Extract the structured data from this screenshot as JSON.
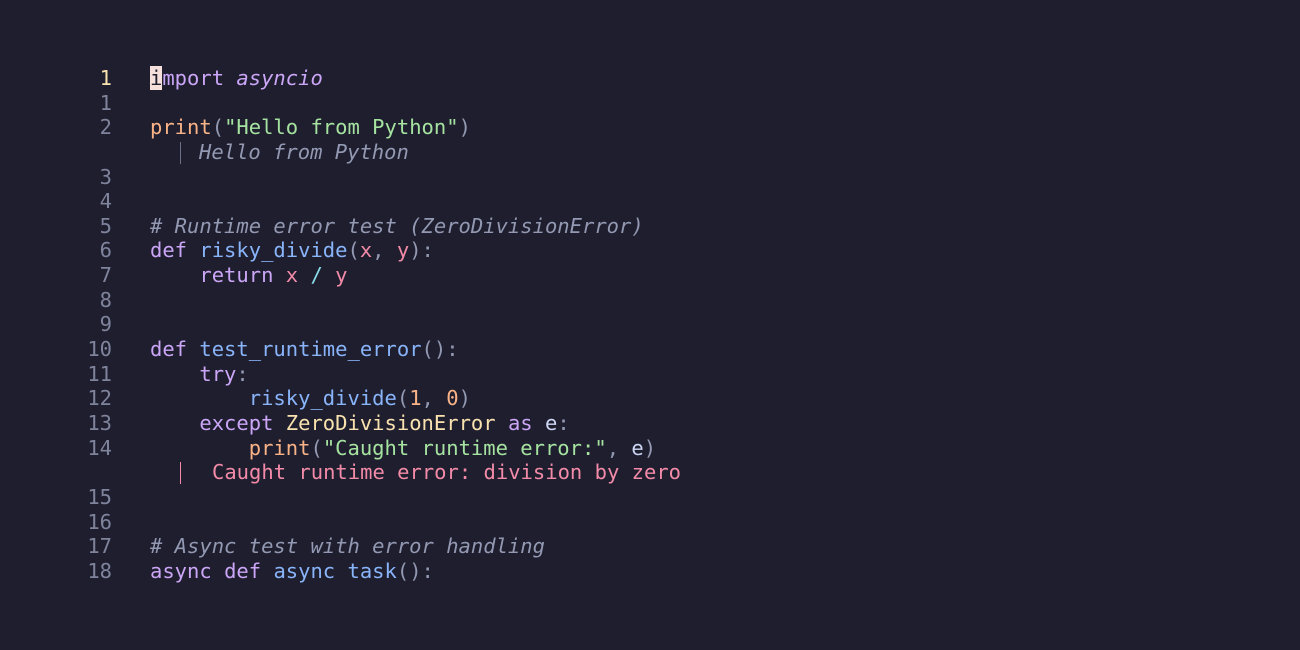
{
  "editor": {
    "theme_colors": {
      "background": "#1e1e2e",
      "keyword": "#cba6f7",
      "function": "#89b4fa",
      "builtin": "#fab387",
      "string": "#a6e3a1",
      "comment": "#9399b2",
      "error_output": "#f38ba8",
      "current_line_number": "#f9e2af"
    },
    "lines": [
      {
        "num": "1",
        "current": true,
        "tokens": [
          {
            "t": "i",
            "c": "cursor"
          },
          {
            "t": "mport",
            "c": "kw"
          },
          {
            "t": " ",
            "c": "var"
          },
          {
            "t": "asyncio",
            "c": "mod"
          }
        ]
      },
      {
        "num": "1",
        "tokens": []
      },
      {
        "num": "2",
        "tokens": [
          {
            "t": "print",
            "c": "bi"
          },
          {
            "t": "(",
            "c": "punc"
          },
          {
            "t": "\"Hello from Python\"",
            "c": "str"
          },
          {
            "t": ")",
            "c": "punc"
          }
        ]
      },
      {
        "output": "Hello from Python",
        "kind": "info"
      },
      {
        "num": "3",
        "tokens": []
      },
      {
        "num": "4",
        "tokens": []
      },
      {
        "num": "5",
        "tokens": [
          {
            "t": "# Runtime error test (ZeroDivisionError)",
            "c": "cmt"
          }
        ]
      },
      {
        "num": "6",
        "tokens": [
          {
            "t": "def",
            "c": "kw"
          },
          {
            "t": " ",
            "c": "var"
          },
          {
            "t": "risky_divide",
            "c": "fn"
          },
          {
            "t": "(",
            "c": "punc"
          },
          {
            "t": "x",
            "c": "param"
          },
          {
            "t": ", ",
            "c": "punc"
          },
          {
            "t": "y",
            "c": "param"
          },
          {
            "t": "):",
            "c": "punc"
          }
        ]
      },
      {
        "num": "7",
        "tokens": [
          {
            "t": "    ",
            "c": "var"
          },
          {
            "t": "return",
            "c": "kw"
          },
          {
            "t": " ",
            "c": "var"
          },
          {
            "t": "x",
            "c": "param"
          },
          {
            "t": " ",
            "c": "var"
          },
          {
            "t": "/",
            "c": "op"
          },
          {
            "t": " ",
            "c": "var"
          },
          {
            "t": "y",
            "c": "param"
          }
        ]
      },
      {
        "num": "8",
        "tokens": []
      },
      {
        "num": "9",
        "tokens": []
      },
      {
        "num": "10",
        "tokens": [
          {
            "t": "def",
            "c": "kw"
          },
          {
            "t": " ",
            "c": "var"
          },
          {
            "t": "test_runtime_error",
            "c": "fn"
          },
          {
            "t": "():",
            "c": "punc"
          }
        ]
      },
      {
        "num": "11",
        "tokens": [
          {
            "t": "    ",
            "c": "var"
          },
          {
            "t": "try",
            "c": "kw"
          },
          {
            "t": ":",
            "c": "punc"
          }
        ]
      },
      {
        "num": "12",
        "tokens": [
          {
            "t": "        ",
            "c": "var"
          },
          {
            "t": "risky_divide",
            "c": "fn"
          },
          {
            "t": "(",
            "c": "punc"
          },
          {
            "t": "1",
            "c": "num"
          },
          {
            "t": ", ",
            "c": "punc"
          },
          {
            "t": "0",
            "c": "num"
          },
          {
            "t": ")",
            "c": "punc"
          }
        ]
      },
      {
        "num": "13",
        "tokens": [
          {
            "t": "    ",
            "c": "var"
          },
          {
            "t": "except",
            "c": "kw"
          },
          {
            "t": " ",
            "c": "var"
          },
          {
            "t": "ZeroDivisionError",
            "c": "cls"
          },
          {
            "t": " ",
            "c": "var"
          },
          {
            "t": "as",
            "c": "kw"
          },
          {
            "t": " e",
            "c": "var"
          },
          {
            "t": ":",
            "c": "punc"
          }
        ]
      },
      {
        "num": "14",
        "tokens": [
          {
            "t": "        ",
            "c": "var"
          },
          {
            "t": "print",
            "c": "bi"
          },
          {
            "t": "(",
            "c": "punc"
          },
          {
            "t": "\"Caught runtime error:\"",
            "c": "str"
          },
          {
            "t": ", ",
            "c": "punc"
          },
          {
            "t": "e",
            "c": "var"
          },
          {
            "t": ")",
            "c": "punc"
          }
        ]
      },
      {
        "output": "Caught runtime error: division by zero",
        "kind": "err"
      },
      {
        "num": "15",
        "tokens": []
      },
      {
        "num": "16",
        "tokens": []
      },
      {
        "num": "17",
        "tokens": [
          {
            "t": "# Async test with error handling",
            "c": "cmt"
          }
        ]
      },
      {
        "num": "18",
        "tokens": [
          {
            "t": "async",
            "c": "kw"
          },
          {
            "t": " ",
            "c": "var"
          },
          {
            "t": "def",
            "c": "kw"
          },
          {
            "t": " ",
            "c": "var"
          },
          {
            "t": "async task",
            "c": "fn"
          },
          {
            "t": "():",
            "c": "punc"
          }
        ]
      }
    ]
  }
}
